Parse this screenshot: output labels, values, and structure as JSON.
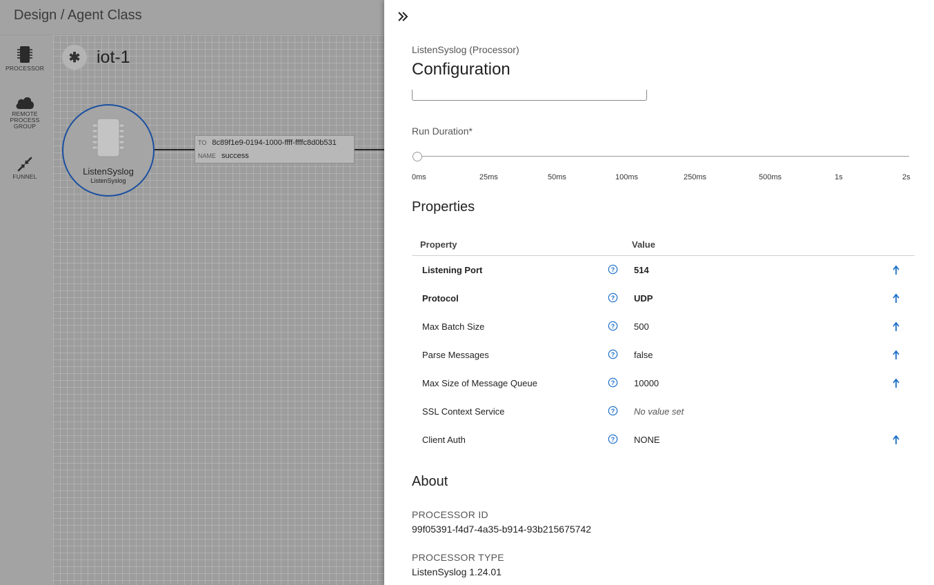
{
  "header": {
    "title": "Design / Agent Class"
  },
  "palette": {
    "items": [
      {
        "label": "PROCESSOR",
        "icon": "processor-icon"
      },
      {
        "label": "REMOTE PROCESS GROUP",
        "label_lines": [
          "REMOTE",
          "PROCESS",
          "GROUP"
        ],
        "icon": "cloud-icon"
      },
      {
        "label": "FUNNEL",
        "icon": "funnel-icon"
      }
    ]
  },
  "canvas": {
    "flow_badge": "✱",
    "flow_name": "iot-1",
    "processor": {
      "name": "ListenSyslog",
      "type": "ListenSyslog"
    },
    "connection": {
      "to_key": "TO",
      "to_value": "8c89f1e9-0194-1000-ffff-ffffc8d0b531",
      "name_key": "NAME",
      "name_value": "success"
    }
  },
  "panel": {
    "subtitle": "ListenSyslog (Processor)",
    "title": "Configuration",
    "run_duration": {
      "label": "Run Duration*",
      "ticks": [
        "0ms",
        "25ms",
        "50ms",
        "100ms",
        "250ms",
        "500ms",
        "1s",
        "2s"
      ],
      "selected": "0ms"
    },
    "properties": {
      "heading": "Properties",
      "col_property": "Property",
      "col_value": "Value",
      "rows": [
        {
          "name": "Listening Port",
          "value": "514",
          "required": true,
          "has_arrow": true
        },
        {
          "name": "Protocol",
          "value": "UDP",
          "required": true,
          "has_arrow": true
        },
        {
          "name": "Max Batch Size",
          "value": "500",
          "required": false,
          "has_arrow": true
        },
        {
          "name": "Parse Messages",
          "value": "false",
          "required": false,
          "has_arrow": true
        },
        {
          "name": "Max Size of Message Queue",
          "value": "10000",
          "required": false,
          "has_arrow": true
        },
        {
          "name": "SSL Context Service",
          "value": "No value set",
          "required": false,
          "has_arrow": false,
          "empty": true
        },
        {
          "name": "Client Auth",
          "value": "NONE",
          "required": false,
          "has_arrow": true
        }
      ]
    },
    "about": {
      "heading": "About",
      "processor_id_key": "PROCESSOR ID",
      "processor_id": "99f05391-f4d7-4a35-b914-93b215675742",
      "processor_type_key": "PROCESSOR TYPE",
      "processor_type": "ListenSyslog 1.24.01"
    }
  },
  "colors": {
    "accent": "#1a6fc9",
    "node_border": "#1a4fa0"
  }
}
